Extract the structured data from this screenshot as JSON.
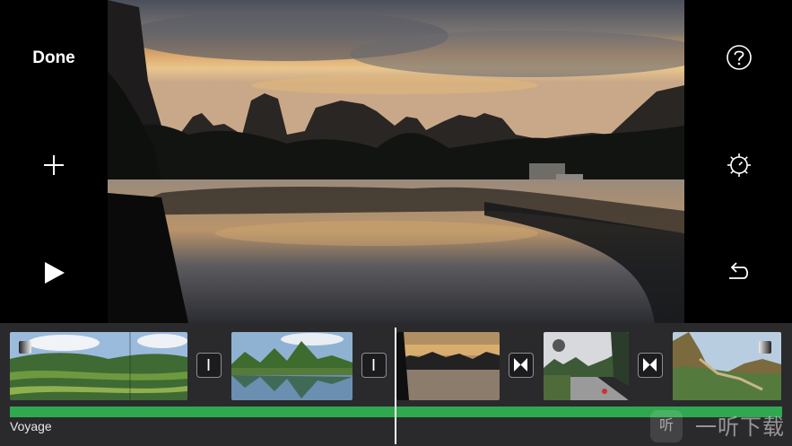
{
  "toolbar": {
    "done_label": "Done"
  },
  "icons": {
    "add": "plus-icon",
    "play": "play-icon",
    "help": "question-circle-icon",
    "settings": "gear-icon",
    "undo": "undo-arrow-icon"
  },
  "timeline": {
    "audio_label": "Voyage",
    "audio_color": "#2fa84f"
  },
  "watermark": {
    "text": "一听下载"
  }
}
